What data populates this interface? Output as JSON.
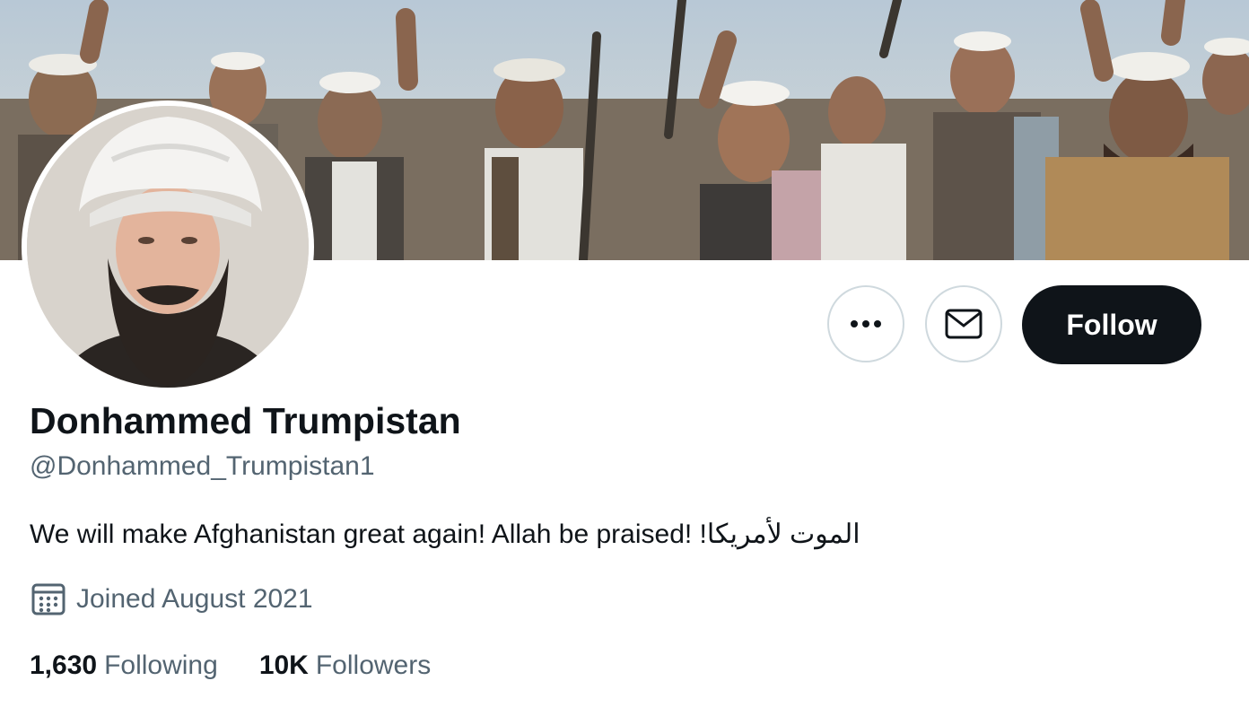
{
  "profile": {
    "display_name": "Donhammed Trumpistan",
    "handle": "@Donhammed_Trumpistan1",
    "bio": "We will make Afghanistan great again! Allah be praised! !الموت لأمريكا",
    "joined": "Joined August 2021"
  },
  "actions": {
    "more_icon": "more-horizontal-icon",
    "mail_icon": "envelope-icon",
    "follow_label": "Follow"
  },
  "stats": {
    "following_count": "1,630",
    "following_label": "Following",
    "followers_count": "10K",
    "followers_label": "Followers"
  },
  "icons": {
    "joined_icon": "calendar-icon"
  },
  "colors": {
    "primary_text": "#0f1419",
    "secondary_text": "#536471",
    "follow_button_bg": "#0f1419",
    "button_border": "#cfd9de"
  }
}
